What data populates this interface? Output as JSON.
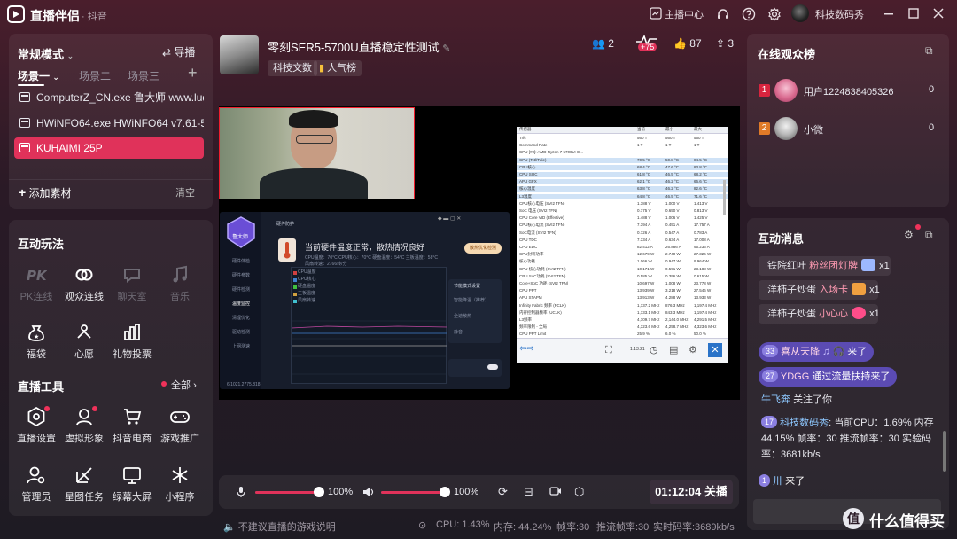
{
  "app": {
    "title": "直播伴侣",
    "subtitle": "· 抖音",
    "broadcast_center": "主播中心",
    "username": "科技数码秀"
  },
  "left": {
    "mode": "常规模式",
    "guide": "导播",
    "scenes": [
      "场景一",
      "场景二",
      "场景三"
    ],
    "sources": [
      "ComputerZ_CN.exe 鲁大师 www.ludashi.com",
      "HWiNFO64.exe HWiNFO64 v7.61-5060",
      "KUHAIMI 25P"
    ],
    "add_source": "添加素材",
    "clear": "清空",
    "interactive_title": "互动玩法",
    "interactive": [
      {
        "label": "PK连线",
        "disabled": true,
        "icon": "pk-icon"
      },
      {
        "label": "观众连线",
        "disabled": false,
        "icon": "link-icon"
      },
      {
        "label": "聊天室",
        "disabled": true,
        "icon": "chat-icon"
      },
      {
        "label": "音乐",
        "disabled": true,
        "icon": "music-icon"
      },
      {
        "label": "福袋",
        "disabled": false,
        "icon": "lucky-bag-icon"
      },
      {
        "label": "心愿",
        "disabled": false,
        "icon": "wish-icon"
      },
      {
        "label": "礼物投票",
        "disabled": false,
        "icon": "vote-icon"
      }
    ],
    "tools_title": "直播工具",
    "tools_all": "全部",
    "tools": [
      {
        "label": "直播设置",
        "icon": "settings-icon",
        "dot": true
      },
      {
        "label": "虚拟形象",
        "icon": "avatar-icon",
        "dot": true
      },
      {
        "label": "抖音电商",
        "icon": "cart-icon",
        "dot": false
      },
      {
        "label": "游戏推广",
        "icon": "gamepad-icon",
        "dot": false
      },
      {
        "label": "管理员",
        "icon": "admin-icon",
        "dot": false
      },
      {
        "label": "星图任务",
        "icon": "star-task-icon",
        "dot": false
      },
      {
        "label": "绿幕大屏",
        "icon": "screen-icon",
        "dot": false
      },
      {
        "label": "小程序",
        "icon": "miniapp-icon",
        "dot": false
      }
    ]
  },
  "stream": {
    "title": "零刻SER5-5700U直播稳定性测试",
    "tags": [
      "科技文数",
      "人气榜"
    ],
    "viewers": "2",
    "trend": "+75",
    "likes": "87",
    "shares": "3",
    "mic_volume": "100%",
    "speaker_volume": "100%",
    "mic_level": 1.0,
    "speaker_level": 1.0,
    "duration": "01:12:04",
    "stop_label": "关播",
    "footer_note": "不建议直播的游戏说明",
    "stats": {
      "cpu": "CPU: 1.43%",
      "mem": "内存: 44.24%",
      "fps": "帧率:30",
      "push_fps": "推流帧率:30",
      "bitrate": "实时码率:3689kb/s"
    }
  },
  "hw_window": {
    "app": "硬件防护",
    "status": "当前硬件温度正常，散热情况良好",
    "cpu_line": "CPU温度：70°C   CPU核心：70°C   硬盘温度：54°C   主板温度：58°C",
    "fan": "风扇转速：2766转/分",
    "button": "散热优化检测",
    "nav": [
      "硬件体检",
      "硬件参数",
      "硬件检测",
      "温度监控",
      "清理优化",
      "驱动检测",
      "上网测速"
    ],
    "legend": [
      "CPU温度",
      "CPU核心",
      "硬盘温度",
      "主板温度",
      "风扇转速"
    ],
    "right_title": "节能模式设置",
    "modes": [
      "智能降温（推荐）",
      "全速散热",
      "静音"
    ],
    "footer": "6.1021.2775.818",
    "badge": "鲁大师"
  },
  "monitor": {
    "header": [
      "传感器",
      "当前",
      "最小",
      "最大"
    ],
    "rows": [
      [
        "Trfc",
        "560 T",
        "560 T",
        "560 T",
        false
      ],
      [
        "Command Rate",
        "1 T",
        "1 T",
        "1 T",
        false
      ],
      [
        "CPU [#0]: AMD Ryzen 7 5700U: E...",
        "",
        "",
        "",
        false
      ],
      [
        "CPU (Tctl/Tdie)",
        "70.5 °C",
        "50.8 °C",
        "84.5 °C",
        true
      ],
      [
        "CPU核心",
        "68.4 °C",
        "47.6 °C",
        "83.8 °C",
        true
      ],
      [
        "CPU SOC",
        "61.8 °C",
        "46.5 °C",
        "68.2 °C",
        true
      ],
      [
        "APU GFX",
        "62.1 °C",
        "46.2 °C",
        "66.6 °C",
        true
      ],
      [
        "核心温度",
        "63.8 °C",
        "46.2 °C",
        "82.6 °C",
        true
      ],
      [
        "L3温度",
        "64.8 °C",
        "46.5 °C",
        "71.6 °C",
        true
      ],
      [
        "CPU核心电压 (SVI2 TFN)",
        "1.388 V",
        "1.000 V",
        "1.413 V",
        false
      ],
      [
        "SoC 电压 (SVI2 TFN)",
        "0.775 V",
        "0.650 V",
        "0.813 V",
        false
      ],
      [
        "CPU Core VID (Effective)",
        "1.488 V",
        "1.006 V",
        "1.425 V",
        false
      ],
      [
        "CPU核心电流 (SVI2 TFN)",
        "7.394 A",
        "0.491 A",
        "17.757 A",
        false
      ],
      [
        "SoC电流 (SVI2 TFN)",
        "0.726 A",
        "0.547 A",
        "0.783 A",
        false
      ],
      [
        "CPU TDC",
        "7.334 A",
        "0.634 A",
        "17.008 A",
        false
      ],
      [
        "CPU EDC",
        "82.412 A",
        "26.886 A",
        "95.236 A",
        false
      ],
      [
        "CPU封装功率",
        "12.679 W",
        "2.740 W",
        "27.326 W",
        false
      ],
      [
        "核心功耗",
        "1.066 W",
        "0.947 W",
        "9.964 W",
        false
      ],
      [
        "CPU 核心功耗 (SVI2 TFN)",
        "10.171 W",
        "0.591 W",
        "23.188 W",
        false
      ],
      [
        "CPU SoC功耗 (SVI2 TFN)",
        "0.585 W",
        "0.396 W",
        "0.615 W",
        false
      ],
      [
        "Core+SoC 功耗 (SVI2 TFN)",
        "10.697 W",
        "1.008 W",
        "23.778 W",
        false
      ],
      [
        "CPU PPT",
        "13.939 W",
        "3.218 W",
        "27.546 W",
        false
      ],
      [
        "APU STAPM",
        "13.913 W",
        "4.288 W",
        "13.933 W",
        false
      ],
      [
        "Infinity Fabric 频率 (FCLK)",
        "1,137.2 MHz",
        "876.3 MHz",
        "1,197.4 MHz",
        false
      ],
      [
        "内存控制器频率 (UCLK)",
        "1,133.1 MHz",
        "843.3 MHz",
        "1,197.4 MHz",
        false
      ],
      [
        "L3频率",
        "4,109.7 MHz",
        "2,144.0 MHz",
        "4,291.5 MHz",
        false
      ],
      [
        "频率限制 - 全局",
        "4,323.6 MHz",
        "4,258.7 MHz",
        "4,323.6 MHz",
        false
      ],
      [
        "CPU PPT Limit",
        "25.9 %",
        "6.0 %",
        "50.0 %",
        false
      ]
    ],
    "time": "1:13:21"
  },
  "audience": {
    "title": "在线观众榜",
    "users": [
      {
        "rank": "1",
        "name": "用户1224838405326",
        "score": "0"
      },
      {
        "rank": "2",
        "name": "小微",
        "score": "0"
      }
    ]
  },
  "messages": {
    "title": "互动消息",
    "gifts": [
      {
        "user": "铁院红叶",
        "text": "粉丝团灯牌",
        "count": "x1",
        "color": "#9db8ff"
      },
      {
        "user": "洋柿子炒蛋",
        "text": "入场卡",
        "count": "x1",
        "color": "#f0a040"
      },
      {
        "user": "洋柿子炒蛋",
        "text": "小心心",
        "count": "x1",
        "color": "#ff4d8a"
      }
    ],
    "entries": [
      {
        "level": "33",
        "user": "喜从天降",
        "action": "来了"
      },
      {
        "level": "27",
        "user": "YDGG",
        "action": "通过流量扶持来了"
      }
    ],
    "follow": {
      "user": "牛飞奔",
      "action": "关注了你"
    },
    "system": {
      "level": "17",
      "user": "科技数码秀",
      "text": "当前CPU：1.69% 内存44.15% 帧率：30 推流帧率：30 实验码率：3681kb/s"
    },
    "last": {
      "level": "1",
      "user": "卅",
      "action": "来了"
    }
  },
  "watermark": {
    "icon": "值",
    "text": "什么值得买"
  }
}
